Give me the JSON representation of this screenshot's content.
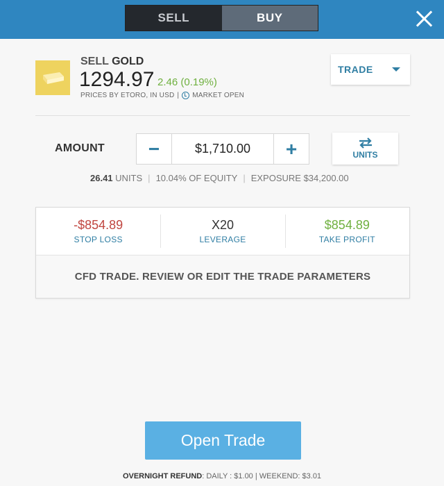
{
  "header": {
    "sell_tab": "SELL",
    "buy_tab": "BUY",
    "close_icon": "close-icon"
  },
  "instrument": {
    "action": "SELL",
    "name": "GOLD",
    "icon": "gold-bar-icon",
    "price": "1294.97",
    "change": "2.46 (0.19%)",
    "source": "PRICES BY ETORO, IN USD",
    "separator": "|",
    "market_status": "MARKET OPEN",
    "change_color": "#6fb03f"
  },
  "order_type": {
    "selected": "TRADE",
    "icon": "chevron-down-icon"
  },
  "amount": {
    "label": "AMOUNT",
    "value": "$1,710.00",
    "minus": "−",
    "plus": "+",
    "units_toggle": "UNITS",
    "units_icon": "swap-arrows-icon"
  },
  "stats": {
    "units_value": "26.41",
    "units_label": "UNITS",
    "equity": "10.04% OF EQUITY",
    "exposure": "EXPOSURE $34,200.00",
    "sep": "|"
  },
  "params": {
    "stop_loss_value": "-$854.89",
    "stop_loss_label": "STOP LOSS",
    "leverage_value": "X20",
    "leverage_label": "LEVERAGE",
    "take_profit_value": "$854.89",
    "take_profit_label": "TAKE PROFIT",
    "note": "CFD TRADE. REVIEW OR EDIT THE TRADE PARAMETERS"
  },
  "actions": {
    "open_trade": "Open Trade",
    "button_color": "#5ab0e3"
  },
  "footer": {
    "label": "OVERNIGHT REFUND",
    "daily": ": DAILY : $1.00",
    "sep": " | ",
    "weekend": "WEEKEND: $3.01"
  }
}
